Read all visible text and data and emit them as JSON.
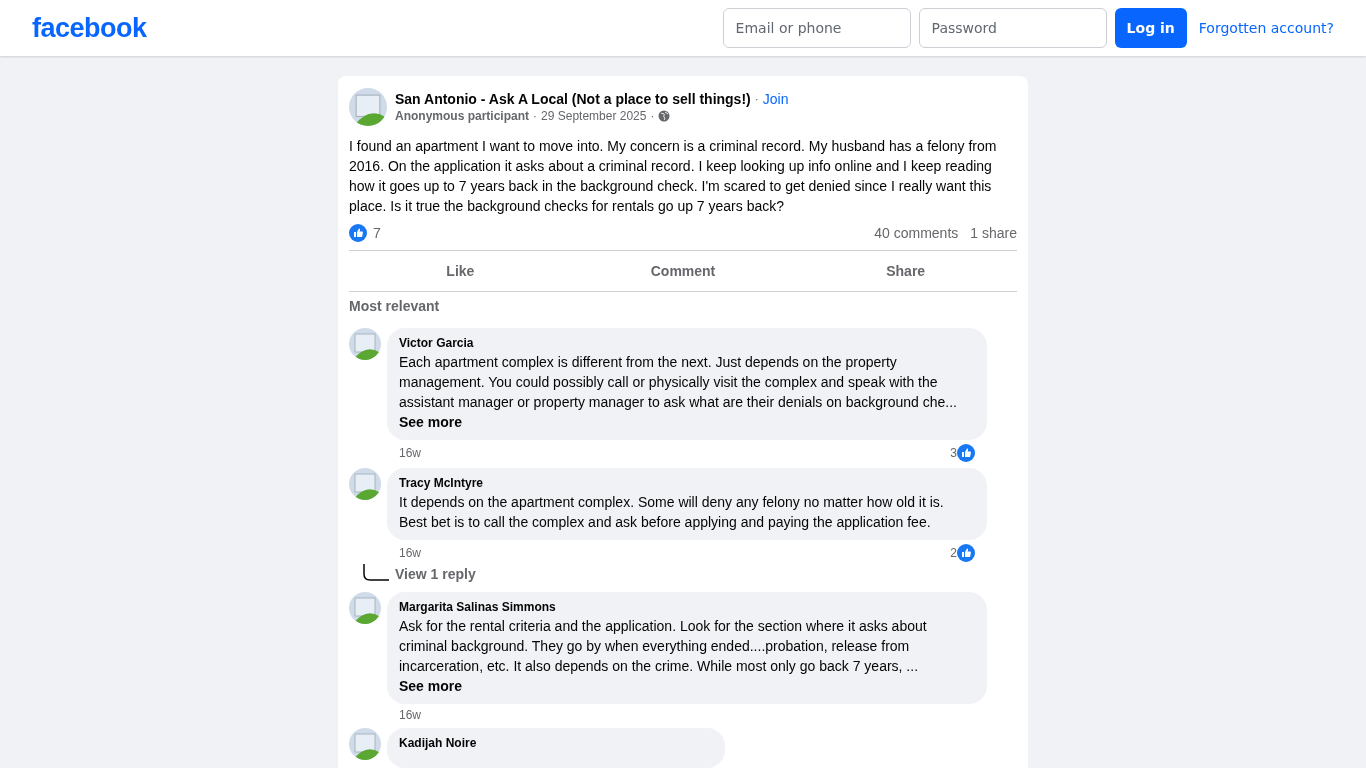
{
  "header": {
    "logo": "facebook",
    "email_placeholder": "Email or phone",
    "password_placeholder": "Password",
    "login": "Log in",
    "forgot": "Forgotten account?"
  },
  "post": {
    "separator": "·",
    "group": "San Antonio - Ask A Local (Not a place to sell things!)",
    "join": "Join",
    "author": "Anonymous participant",
    "date": "29 September 2025",
    "text": "I found an apartment I want to move into. My concern is a criminal record. My husband has a  felony from 2016. On the application it asks about a criminal record. I keep looking up info online and I keep reading how it goes up to 7 years back in the background check. I'm scared to get denied since I really want this place. Is it true the background checks for rentals go up 7 years back?",
    "reactions": "7",
    "comments": "40 comments",
    "shares": "1 share"
  },
  "actions": [
    "Like",
    "Comment",
    "Share"
  ],
  "sort": "Most relevant",
  "comments": [
    {
      "author": "Victor Garcia",
      "text": "Each apartment complex is different from the next. Just depends on the property management. You could possibly call or physically visit the complex and speak with the assistant manager or property manager to ask what are their denials on background che...",
      "see_more": "See more",
      "time": "16w",
      "likes": "3"
    },
    {
      "author": "Tracy McIntyre",
      "text": "It depends on the apartment complex. Some will deny any felony no matter how old it is. Best bet is to call the complex and ask before applying and paying the application fee.",
      "time": "16w",
      "likes": "2",
      "replies": "View 1 reply"
    },
    {
      "author": "Margarita Salinas Simmons",
      "text": "Ask for the rental criteria and the application. Look for the section where it asks about criminal background. They go by when everything ended....probation, release from incarceration, etc. It also depends on the crime. While most only go back 7 years, ...",
      "see_more": "See more",
      "time": "16w"
    },
    {
      "author": "Kadijah Noire"
    }
  ]
}
